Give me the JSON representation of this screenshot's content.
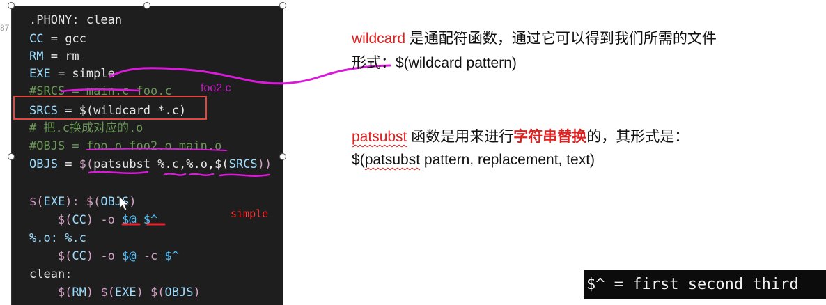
{
  "gutter_number": "87",
  "code": {
    "line1": ".PHONY: clean",
    "line2_var": "CC",
    "line2_rest": " = gcc",
    "line3_var": "RM",
    "line3_rest": " = rm",
    "line4_var": "EXE",
    "line4_rest": " = simple",
    "line5": "#SRCS = main.c foo.c",
    "line6_var": "SRCS",
    "line6_eq": " = ",
    "line6_rest": "$(wildcard *.c)",
    "line7": "# 把.c换成对应的.o",
    "line8": "#OBJS = foo.o foo2.o main.o",
    "line9_var": "OBJS",
    "line9_eq": " = ",
    "line9_a": "$(",
    "line9_fn": "patsubst",
    "line9_b": " %.c,%.o,$(",
    "line9_c": "SRCS",
    "line9_d": "))",
    "line11_a": "$(",
    "line11_b": "EXE",
    "line11_c": "): $(",
    "line11_d": "OBJS",
    "line11_e": ")",
    "line12_a": "    $(",
    "line12_b": "CC",
    "line12_c": ") -o ",
    "line12_d": "$@",
    "line12_e": " $^",
    "line13": "%.o: %.c",
    "line14_a": "    $(",
    "line14_b": "CC",
    "line14_c": ") -o ",
    "line14_d": "$@",
    "line14_e": " -c ",
    "line14_f": "$^",
    "line15": "clean:",
    "line16_a": "    $(",
    "line16_b": "RM",
    "line16_c": ") $(",
    "line16_d": "EXE",
    "line16_e": ") $(",
    "line16_f": "OBJS",
    "line16_g": ")"
  },
  "annotations": {
    "foo2": "foo2.c",
    "simple": "simple"
  },
  "descriptions": {
    "wildcard_term": "wildcard",
    "wildcard_line1": " 是通配符函数，通过它可以得到我们所需的文件",
    "wildcard_line2": "形式：$(wildcard pattern)",
    "patsubst_term": "patsubst",
    "patsubst_mid": " 函数是用来进行",
    "patsubst_bold": "字符串替换",
    "patsubst_end": "的，其形式是：",
    "patsubst_line2_a": "$(",
    "patsubst_line2_term": "patsubst",
    "patsubst_line2_b": " pattern, replacement, text)"
  },
  "terminal": {
    "text": "$^ = first second third"
  },
  "colors": {
    "code_bg": "#1e1e1e",
    "highlight_border": "#e8453c",
    "pen_magenta": "#d81bd8",
    "pen_red": "#e8202a",
    "term_red": "#e02020"
  }
}
